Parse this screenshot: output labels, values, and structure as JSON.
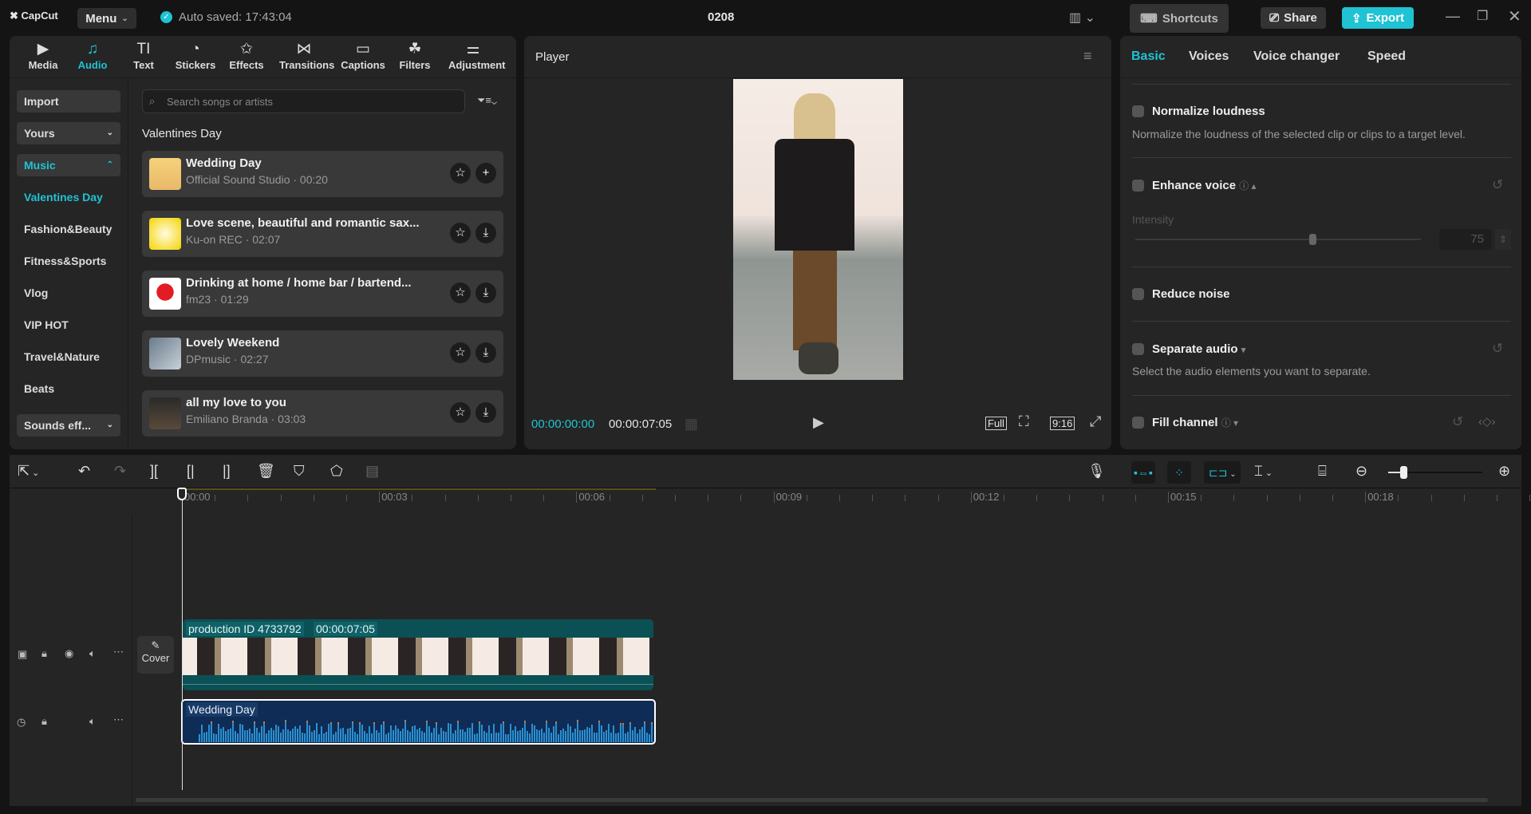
{
  "app": {
    "logo": "CapCut",
    "menu": "Menu",
    "autosave": "Auto saved: 17:43:04",
    "title": "0208",
    "shortcuts": "Shortcuts",
    "share": "Share",
    "export": "Export",
    "accent": "#1fc3d3"
  },
  "tabs": [
    {
      "label": "Media",
      "icon": "▶"
    },
    {
      "label": "Audio",
      "icon": "♫"
    },
    {
      "label": "Text",
      "icon": "TI"
    },
    {
      "label": "Stickers",
      "icon": "◔"
    },
    {
      "label": "Effects",
      "icon": "✩"
    },
    {
      "label": "Transitions",
      "icon": "⋈"
    },
    {
      "label": "Captions",
      "icon": "▭"
    },
    {
      "label": "Filters",
      "icon": "☘"
    },
    {
      "label": "Adjustment",
      "icon": "⚌"
    }
  ],
  "sidebar": [
    "Import",
    "Yours",
    "Music",
    "Valentines Day",
    "Fashion&Beauty",
    "Fitness&Sports",
    "Vlog",
    "VIP HOT",
    "Travel&Nature",
    "Beats",
    "Sounds eff..."
  ],
  "search": {
    "placeholder": "Search songs or artists"
  },
  "category": "Valentines Day",
  "songs": [
    {
      "title": "Wedding Day",
      "sub": "Official Sound Studio · 00:20",
      "action": "+"
    },
    {
      "title": "Love scene, beautiful and romantic sax...",
      "sub": "Ku-on REC · 02:07",
      "action": "⤓"
    },
    {
      "title": "Drinking at home / home bar / bartend...",
      "sub": "fm23 · 01:29",
      "action": "⤓"
    },
    {
      "title": "Lovely Weekend",
      "sub": "DPmusic · 02:27",
      "action": "⤓"
    },
    {
      "title": "all my love to you",
      "sub": "Emiliano Branda · 03:03",
      "action": "⤓"
    }
  ],
  "player": {
    "title": "Player",
    "current": "00:00:00:00",
    "total": "00:00:07:05",
    "full": "Full",
    "ratio": "9:16"
  },
  "right": {
    "tabs": [
      "Basic",
      "Voices",
      "Voice changer",
      "Speed"
    ],
    "normalize": "Normalize loudness",
    "normalize_desc": "Normalize the loudness of the selected clip or clips to a target level.",
    "enhance": "Enhance voice",
    "intensity": "Intensity",
    "intensity_value": "75",
    "intensity_fraction": 0.75,
    "noise": "Reduce noise",
    "separate": "Separate audio",
    "separate_desc": "Select the audio elements you want to separate.",
    "fill": "Fill channel"
  },
  "timeline": {
    "ruler": [
      "00:00",
      "00:03",
      "00:06",
      "00:09",
      "00:12",
      "00:15",
      "00:18"
    ],
    "cover": "Cover",
    "video_clip": "production ID 4733792",
    "video_dur": "00:00:07:05",
    "audio_clip": "Wedding Day",
    "zoom_fraction": 0.15
  }
}
